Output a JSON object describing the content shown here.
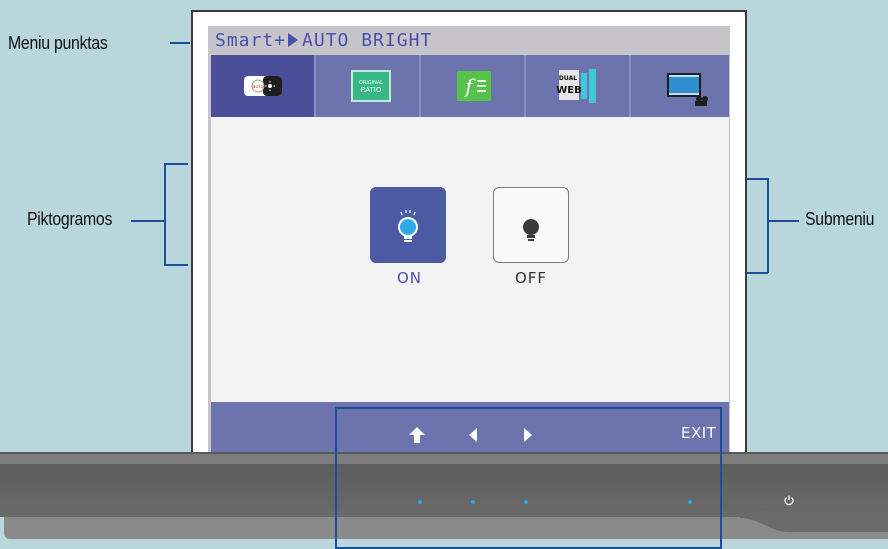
{
  "annotations": {
    "menu_item": "Meniu punktas",
    "icons": "Piktogramos",
    "submenu": "Submeniu"
  },
  "osd": {
    "breadcrumb_root": "Smart+",
    "breadcrumb_current": "AUTO BRIGHT",
    "tabs": [
      {
        "name": "auto-bright",
        "icon": "auto-bright-icon",
        "text": "auto"
      },
      {
        "name": "original-ratio",
        "icon": "original-ratio-icon",
        "text_top": "ORIGINAL",
        "text_bottom": "RATIO"
      },
      {
        "name": "f-engine",
        "icon": "f-engine-icon",
        "text": "f"
      },
      {
        "name": "dual-web",
        "icon": "dual-web-icon",
        "text_top": "DUAL",
        "text_bottom": "WEB"
      },
      {
        "name": "cinema-mode",
        "icon": "cinema-mode-icon"
      }
    ],
    "options": [
      {
        "label": "ON",
        "selected": true
      },
      {
        "label": "OFF",
        "selected": false
      }
    ],
    "nav": {
      "exit_label": "EXIT"
    }
  },
  "colors": {
    "accent": "#4b4f9a",
    "bar": "#6d73ad",
    "indicator": "#2fa9e8",
    "callout": "#1b4f9a"
  }
}
